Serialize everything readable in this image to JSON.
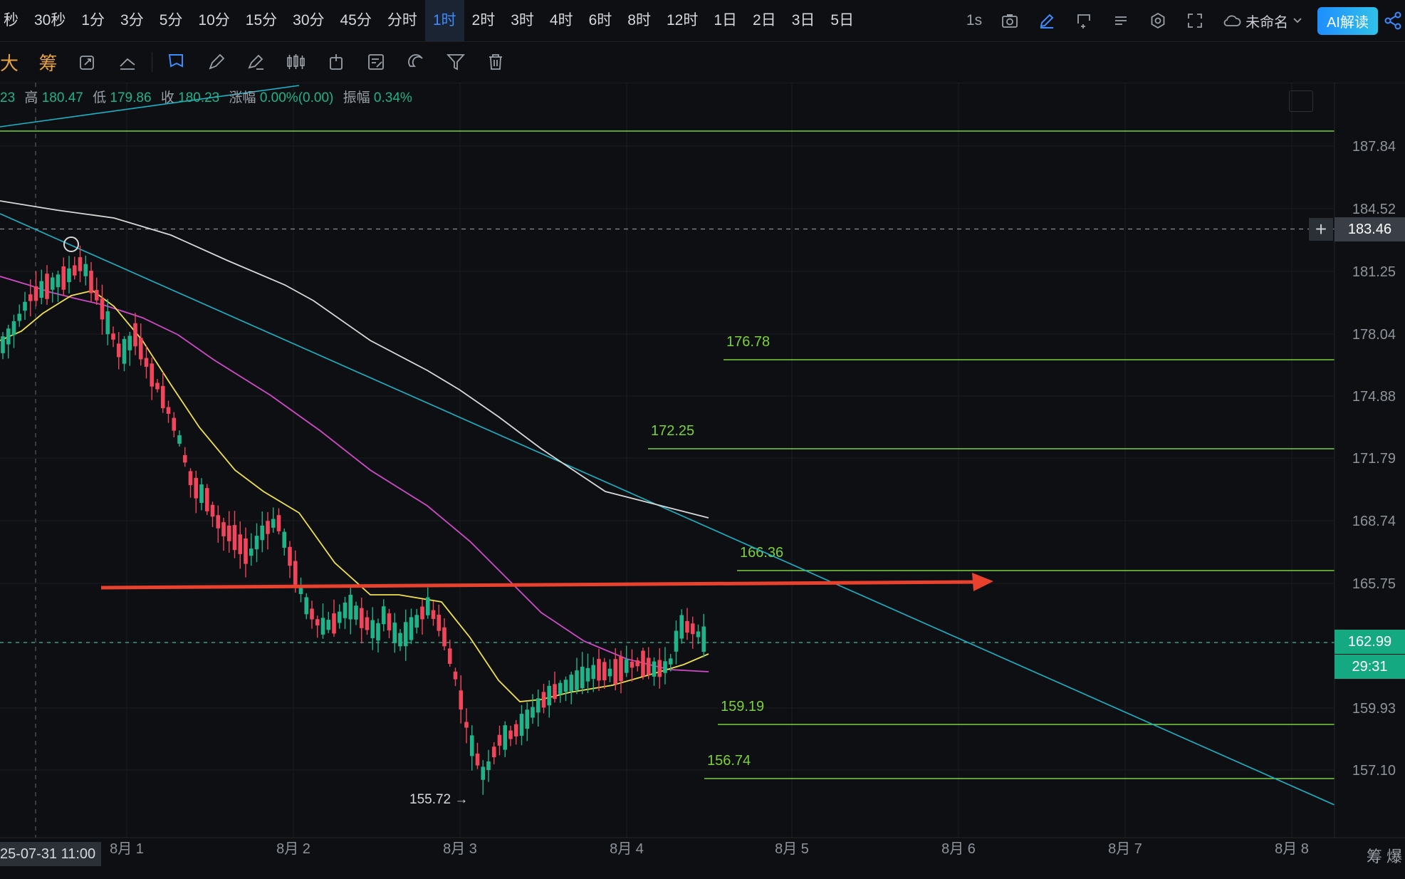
{
  "timeframes": [
    "秒",
    "30秒",
    "1分",
    "3分",
    "5分",
    "10分",
    "15分",
    "30分",
    "45分",
    "分时",
    "1时",
    "2时",
    "3时",
    "4时",
    "6时",
    "8时",
    "12时",
    "1日",
    "2日",
    "3日",
    "5日"
  ],
  "active_timeframe_index": 10,
  "top_right": {
    "interval": "1s",
    "workspace": "未命名",
    "ai_button": "AI解读"
  },
  "toolbar2": {
    "text1": "大",
    "text2": "筹"
  },
  "ohlc": {
    "open_partial": "23",
    "high_label": "高",
    "high": "180.47",
    "low_label": "低",
    "low": "179.86",
    "close_label": "收",
    "close": "180.23",
    "change_label": "涨幅",
    "change": "0.00%(0.00)",
    "amplitude_label": "振幅",
    "amplitude": "0.34%"
  },
  "price_axis": {
    "ticks": [
      "187.84",
      "184.52",
      "181.25",
      "178.04",
      "174.88",
      "171.79",
      "168.74",
      "165.75",
      "162.99",
      "159.93",
      "157.10"
    ]
  },
  "crosshair_price": "183.46",
  "current_price": "162.99",
  "countdown": "29:31",
  "time_axis": {
    "labels": [
      "25-07-31 11:00",
      "8月 1",
      "8月 2",
      "8月 3",
      "8月 4",
      "8月 5",
      "8月 6",
      "8月 7",
      "8月 8"
    ],
    "right_text": "筹  爆"
  },
  "chart_data": {
    "type": "candlestick",
    "interval": "1h",
    "price_scale_note": "nonlinear axis as labeled",
    "horizontal_levels": [
      "176.78",
      "172.25",
      "166.36",
      "159.19",
      "156.74"
    ],
    "low_marker": "155.72",
    "colors": {
      "up": "#1fb38a",
      "down": "#f0455a",
      "ma_yellow": "#f0e04a",
      "ma_magenta": "#d04ac8",
      "ma_white": "#d8d8d8",
      "trendline": "#19b4c8",
      "levels": "#7bd13a",
      "arrow": "#e8412e"
    }
  }
}
